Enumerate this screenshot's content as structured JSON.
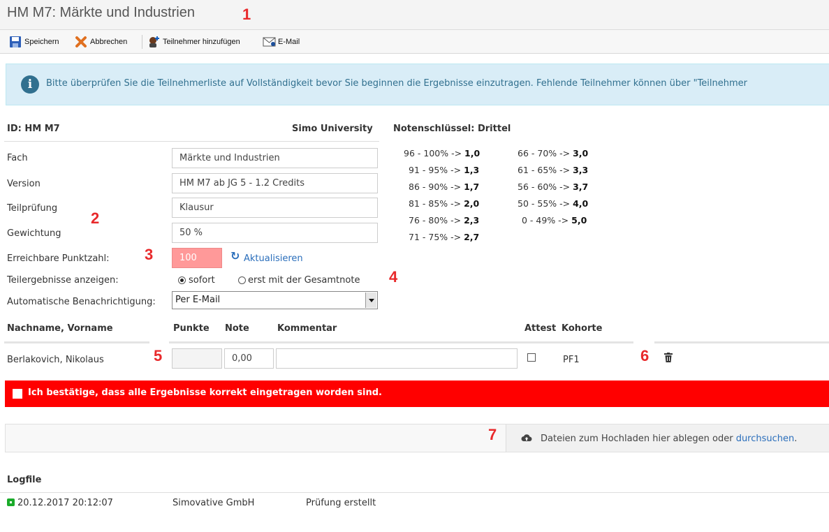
{
  "header": {
    "title": "HM M7: Märkte und Industrien"
  },
  "toolbar": {
    "save_label": "Speichern",
    "cancel_label": "Abbrechen",
    "add_participant_label": "Teilnehmer hinzufügen",
    "email_label": "E-Mail"
  },
  "info": {
    "message": "Bitte überprüfen Sie die Teilnehmerliste auf Vollständigkeit bevor Sie beginnen die Ergebnisse einzutragen. Fehlende Teilnehmer können über \"Teilnehmer"
  },
  "exam": {
    "id_label": "ID: HM M7",
    "university": "Simo University",
    "grade_key_title": "Notenschlüssel: Drittel",
    "fields": [
      {
        "label": "Fach",
        "value": "Märkte und Industrien"
      },
      {
        "label": "Version",
        "value": "HM M7 ab JG 5 - 1.2 Credits"
      },
      {
        "label": "Teilprüfung",
        "value": "Klausur"
      },
      {
        "label": "Gewichtung",
        "value": "50 %"
      }
    ],
    "max_points_label": "Erreichbare Punktzahl:",
    "max_points_value": "100",
    "refresh_label": "Aktualisieren",
    "show_results_label": "Teilergebnisse anzeigen:",
    "radio_immediate": "sofort",
    "radio_with_total": "erst mit der Gesamtnote",
    "notification_label": "Automatische Benachrichtigung:",
    "notification_value": "Per E-Mail"
  },
  "grade_key": {
    "left": [
      {
        "range": "96 - 100% ->",
        "grade": "1,0"
      },
      {
        "range": "91 - 95% ->",
        "grade": "1,3"
      },
      {
        "range": "86 - 90% ->",
        "grade": "1,7"
      },
      {
        "range": "81 - 85% ->",
        "grade": "2,0"
      },
      {
        "range": "76 - 80% ->",
        "grade": "2,3"
      },
      {
        "range": "71 - 75% ->",
        "grade": "2,7"
      }
    ],
    "right": [
      {
        "range": "66 - 70% ->",
        "grade": "3,0"
      },
      {
        "range": "61 - 65% ->",
        "grade": "3,3"
      },
      {
        "range": "56 - 60% ->",
        "grade": "3,7"
      },
      {
        "range": "50 - 55% ->",
        "grade": "4,0"
      },
      {
        "range": "0 - 49% ->",
        "grade": "5,0"
      }
    ]
  },
  "table": {
    "columns": {
      "name": "Nachname, Vorname",
      "points": "Punkte",
      "grade": "Note",
      "comment": "Kommentar",
      "attest": "Attest",
      "cohort": "Kohorte"
    },
    "rows": [
      {
        "name": "Berlakovich, Nikolaus",
        "points": "",
        "grade": "0,00",
        "comment": "",
        "cohort": "PF1"
      }
    ]
  },
  "confirm": {
    "label": "Ich bestätige, dass alle Ergebnisse korrekt eingetragen worden sind."
  },
  "upload": {
    "text": "Dateien zum Hochladen hier ablegen oder ",
    "link": "durchsuchen",
    "suffix": "."
  },
  "logfile": {
    "title": "Logfile",
    "entries": [
      {
        "timestamp": "20.12.2017 20:12:07",
        "user": "Simovative GmbH",
        "action": "Prüfung erstellt"
      }
    ]
  },
  "markers": [
    "1",
    "2",
    "3",
    "4",
    "5",
    "6",
    "7"
  ],
  "colors": {
    "confirm_bar": "#ff0000",
    "info_bg": "#d9edf7",
    "points_field": "#ff9999",
    "marker": "#e8292b",
    "link": "#2a6ebb"
  }
}
